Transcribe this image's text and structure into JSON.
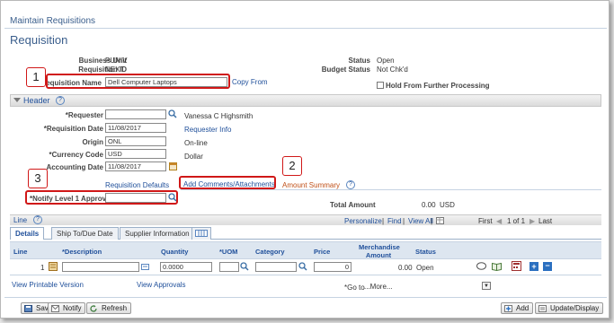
{
  "breadcrumb": "Maintain Requisitions",
  "page_title": "Requisition",
  "info": {
    "business_unit_label": "Business Unit",
    "business_unit_value": "PUNIV",
    "requisition_id_label": "Requisition ID",
    "requisition_id_value": "NEXT",
    "status_label": "Status",
    "status_value": "Open",
    "budget_status_label": "Budget Status",
    "budget_status_value": "Not Chk'd",
    "requisition_name_label": "Requisition Name",
    "requisition_name_value": "Dell Computer Laptops",
    "copy_from": "Copy From",
    "hold_label": "Hold From Further Processing"
  },
  "header": {
    "title": "Header",
    "requester_label": "*Requester",
    "requester_value": "",
    "requester_name": "Vanessa C Highsmith",
    "requisition_date_label": "*Requisition Date",
    "requisition_date_value": "11/08/2017",
    "requester_info": "Requester Info",
    "origin_label": "Origin",
    "origin_value": "ONL",
    "origin_desc": "On-line",
    "currency_label": "*Currency Code",
    "currency_value": "USD",
    "currency_desc": "Dollar",
    "accounting_date_label": "Accounting Date",
    "accounting_date_value": "11/08/2017",
    "requisition_defaults": "Requisition Defaults",
    "add_comments": "Add Comments/Attachments",
    "amount_summary": "Amount Summary",
    "approver_label": "*Notify Level 1 Approver",
    "approver_value": "",
    "total_amount_label": "Total Amount",
    "total_amount_value": "0.00",
    "total_amount_currency": "USD"
  },
  "callouts": {
    "one": "1",
    "two": "2",
    "three": "3"
  },
  "grid": {
    "title": "Line",
    "personalize": "Personalize",
    "sep1": "|",
    "find": "Find",
    "sep2": "|",
    "view_all": "View All",
    "sep3": "|",
    "first": "First",
    "range": "1 of 1",
    "last": "Last",
    "tabs": [
      "Details",
      "Ship To/Due Date",
      "Supplier Information"
    ],
    "columns": [
      "Line",
      "*Description",
      "Quantity",
      "*UOM",
      "Category",
      "Price",
      "Merchandise Amount",
      "Status"
    ],
    "rows": [
      {
        "line": "1",
        "description": "",
        "quantity": "0.0000",
        "uom": "",
        "category": "",
        "price": "0",
        "amount": "0.00",
        "status": "Open"
      }
    ]
  },
  "links": {
    "view_printable": "View Printable Version",
    "view_approvals": "View Approvals",
    "goto_label": "*Go to",
    "goto_value": "...More..."
  },
  "footer": {
    "save": "Save",
    "notify": "Notify",
    "refresh": "Refresh",
    "add": "Add",
    "update_display": "Update/Display"
  },
  "colors": {
    "accent": "#1f4f9a",
    "callout": "#d01818",
    "header_bg": "#dde6f0"
  }
}
